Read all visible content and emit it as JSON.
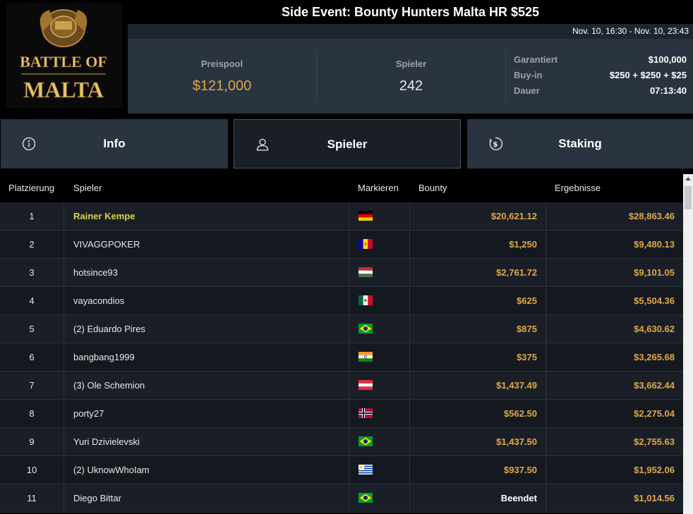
{
  "logo": {
    "line1": "BATTLE OF",
    "line2": "MALTA"
  },
  "header": {
    "title": "Side Event: Bounty Hunters Malta HR $525",
    "dates": "Nov. 10, 16:30 - Nov. 10, 23:43"
  },
  "stats": {
    "prize_label": "Preispool",
    "prize_value": "$121,000",
    "players_label": "Spieler",
    "players_value": "242",
    "details": [
      {
        "key": "Garantiert",
        "value": "$100,000"
      },
      {
        "key": "Buy-in",
        "value": "$250 + $250 + $25"
      },
      {
        "key": "Dauer",
        "value": "07:13:40"
      }
    ]
  },
  "tabs": [
    {
      "label": "Info",
      "icon": "info-icon"
    },
    {
      "label": "Spieler",
      "icon": "user-icon"
    },
    {
      "label": "Staking",
      "icon": "dollar-coin-icon"
    }
  ],
  "table": {
    "headers": {
      "rank": "Platzierung",
      "player": "Spieler",
      "flag": "Markieren",
      "bounty": "Bounty",
      "result": "Ergebnisse"
    },
    "rows": [
      {
        "rank": "1",
        "name": "Rainer Kempe",
        "flag": "germany",
        "bounty": "$20,621.12",
        "result": "$28,863.46"
      },
      {
        "rank": "2",
        "name": "VIVAGGPOKER",
        "flag": "andorra",
        "bounty": "$1,250",
        "result": "$9,480.13"
      },
      {
        "rank": "3",
        "name": "hotsince93",
        "flag": "hungary",
        "bounty": "$2,761.72",
        "result": "$9,101.05"
      },
      {
        "rank": "4",
        "name": "vayacondios",
        "flag": "mexico",
        "bounty": "$625",
        "result": "$5,504.36"
      },
      {
        "rank": "5",
        "name": "(2) Eduardo Pires",
        "flag": "brazil",
        "bounty": "$875",
        "result": "$4,630.62"
      },
      {
        "rank": "6",
        "name": "bangbang1999",
        "flag": "india",
        "bounty": "$375",
        "result": "$3,265.68"
      },
      {
        "rank": "7",
        "name": "(3) Ole Schemion",
        "flag": "austria",
        "bounty": "$1,437.49",
        "result": "$3,662.44"
      },
      {
        "rank": "8",
        "name": "porty27",
        "flag": "norway",
        "bounty": "$562.50",
        "result": "$2,275.04"
      },
      {
        "rank": "9",
        "name": "Yuri Dzivielevski",
        "flag": "brazil",
        "bounty": "$1,437.50",
        "result": "$2,755.63"
      },
      {
        "rank": "10",
        "name": "(2) UknowWhoIam",
        "flag": "uruguay",
        "bounty": "$937.50",
        "result": "$1,952.06"
      },
      {
        "rank": "11",
        "name": "Diego Bittar",
        "flag": "brazil",
        "bounty": "Beendet",
        "result": "$1,014.56"
      }
    ]
  },
  "colors": {
    "accent_gold": "#e0a846",
    "winner_yellow": "#d8d545",
    "panel": "#2a3340"
  }
}
